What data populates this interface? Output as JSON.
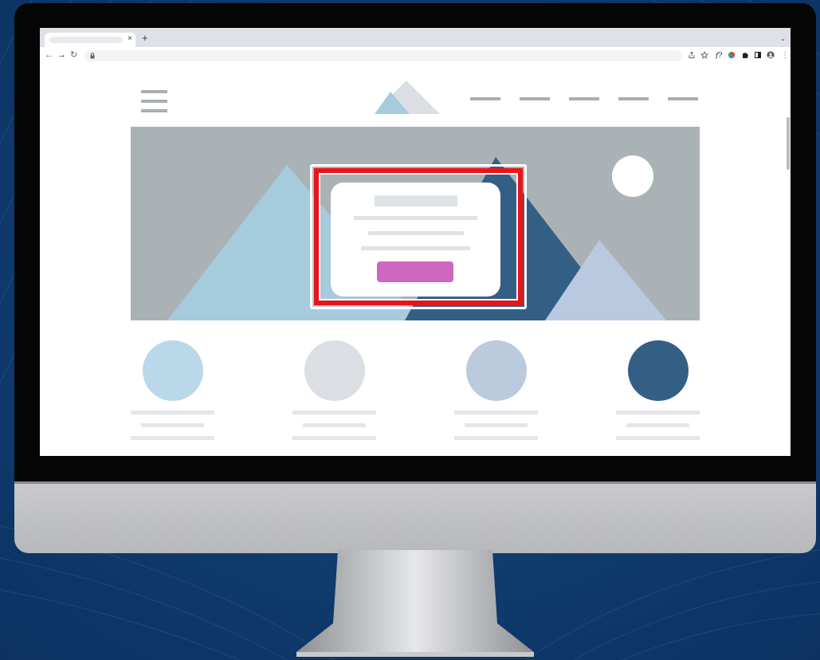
{
  "colors": {
    "backdrop": "#0f3a68",
    "bezel": "#050505",
    "chin": "#c1c2c4",
    "placeholder_gray": "#a9aeb2",
    "hero_bg": "#abb2b6",
    "mountain_light": "#a5cbdc",
    "mountain_dark": "#345f85",
    "mountain_pale": "#b9c9e0",
    "highlight_red": "#e8141a",
    "cta_button": "#cf66c0",
    "text_placeholder": "#dde3e7"
  },
  "browser": {
    "tab_title": "",
    "tab_close_glyph": "×",
    "new_tab_glyph": "+",
    "tab_menu_glyph": "⌄",
    "address_url": "",
    "toolbar_icons": [
      "back-icon",
      "forward-icon",
      "reload-icon",
      "lock-icon",
      "share-icon",
      "bookmark-star-icon",
      "function-icon",
      "color-wheel-icon",
      "extensions-icon",
      "side-panel-icon",
      "profile-avatar-icon",
      "menu-kebab-icon"
    ]
  },
  "site": {
    "nav_link_count_placeholder": "",
    "logo": "mountain-logo",
    "hero": {
      "sun": "sun-circle",
      "modal": {
        "heading": "",
        "body_lines": [
          "",
          "",
          ""
        ],
        "button_label": ""
      }
    },
    "features": [
      {
        "color": "#b9d8ea",
        "title": "",
        "text": ""
      },
      {
        "color": "#dbdfe3",
        "title": "",
        "text": ""
      },
      {
        "color": "#bccade",
        "title": "",
        "text": ""
      },
      {
        "color": "#345f85",
        "title": "",
        "text": ""
      }
    ]
  }
}
